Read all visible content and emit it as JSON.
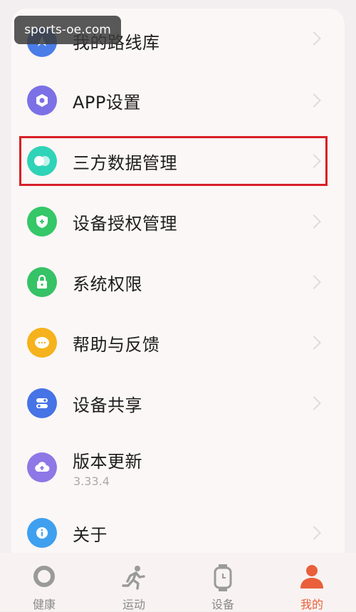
{
  "watermark": "sports-oe.com",
  "menu": {
    "items": [
      {
        "label": "我的路线库",
        "icon": "route-library-icon",
        "color": "#4a7de8"
      },
      {
        "label": "APP设置",
        "icon": "settings-icon",
        "color": "#7c70e6"
      },
      {
        "label": "三方数据管理",
        "icon": "third-party-data-icon",
        "color": "#2fd3b8"
      },
      {
        "label": "设备授权管理",
        "icon": "shield-plus-icon",
        "color": "#35c768"
      },
      {
        "label": "系统权限",
        "icon": "lock-icon",
        "color": "#36c266"
      },
      {
        "label": "帮助与反馈",
        "icon": "chat-bubble-icon",
        "color": "#f5b21c"
      },
      {
        "label": "设备共享",
        "icon": "toggle-share-icon",
        "color": "#4673e5"
      },
      {
        "label": "版本更新",
        "icon": "cloud-upload-icon",
        "color": "#8e77e6",
        "sub": "3.33.4"
      },
      {
        "label": "关于",
        "icon": "info-icon",
        "color": "#3fa0f0"
      }
    ]
  },
  "tabs": [
    {
      "label": "健康",
      "icon": "health-ring-icon"
    },
    {
      "label": "运动",
      "icon": "running-icon"
    },
    {
      "label": "设备",
      "icon": "watch-icon"
    },
    {
      "label": "我的",
      "icon": "profile-icon",
      "active": true
    }
  ],
  "colors": {
    "accent": "#e9603a",
    "highlight_border": "#d72027"
  }
}
